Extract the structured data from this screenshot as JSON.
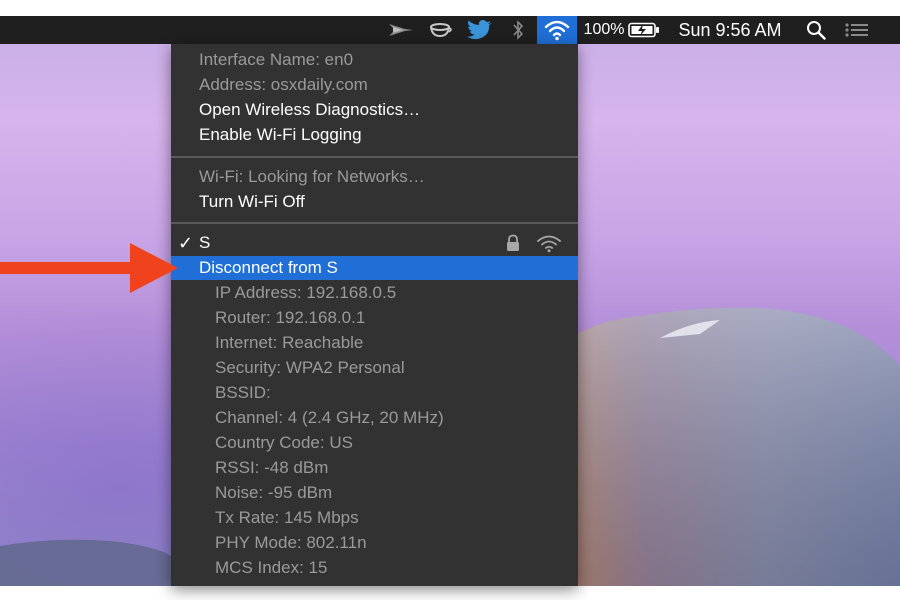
{
  "menubar": {
    "icons": [
      "scissors-plane-icon",
      "coffee-cup-icon",
      "twitter-bird-icon",
      "bluetooth-icon",
      "wifi-icon",
      "search-icon",
      "list-icon"
    ],
    "battery_percent": "100%",
    "clock": "Sun 9:56 AM",
    "colors": {
      "bar": "#1f1f1f",
      "highlight": "#1f6fd6",
      "twitter": "#3b94d9"
    }
  },
  "wifi_menu": {
    "interface_name": "Interface Name: en0",
    "address": "Address: osxdaily.com",
    "open_diagnostics": "Open Wireless Diagnostics…",
    "enable_logging": "Enable Wi-Fi Logging",
    "status": "Wi-Fi: Looking for Networks…",
    "turn_off": "Turn Wi-Fi Off",
    "network": {
      "check": "✓",
      "name": "S",
      "locked": true,
      "signal_icon": "wifi-signal-icon"
    },
    "disconnect": "Disconnect from S",
    "details": [
      "IP Address: 192.168.0.5",
      "Router: 192.168.0.1",
      "Internet: Reachable",
      "Security: WPA2 Personal",
      "BSSID:",
      "Channel: 4 (2.4 GHz, 20 MHz)",
      "Country Code: US",
      "RSSI: -48 dBm",
      "Noise: -95 dBm",
      "Tx Rate: 145 Mbps",
      "PHY Mode: 802.11n",
      "MCS Index: 15"
    ],
    "colors": {
      "background": "#323232",
      "selected": "#1f6fd6",
      "disabled_text": "#9a9a9a"
    }
  },
  "annotation": {
    "arrow_color": "#f0421c"
  }
}
